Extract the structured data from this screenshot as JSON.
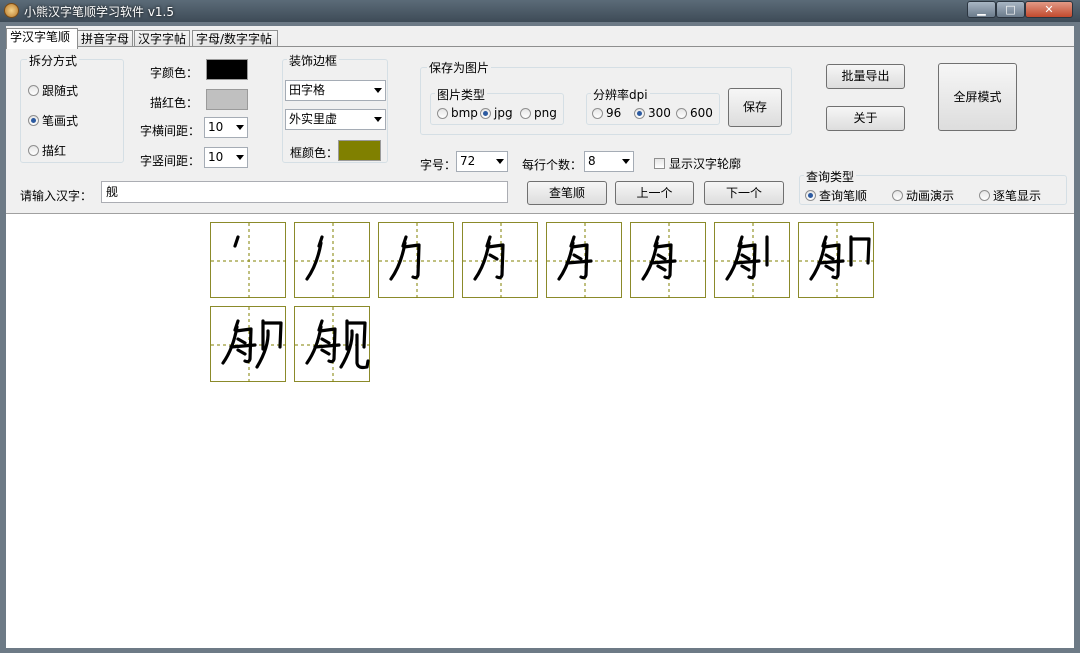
{
  "window": {
    "title": "小熊汉字笔顺学习软件 v1.5"
  },
  "tabs": [
    "学汉字笔顺",
    "拼音字母",
    "汉字字帖",
    "字母/数字字帖"
  ],
  "split": {
    "title": "拆分方式",
    "options": [
      "跟随式",
      "笔画式",
      "描红"
    ],
    "selected": 1
  },
  "colors": {
    "char_label": "字颜色：",
    "char_color": "#000000",
    "trace_label": "描红色：",
    "trace_color": "#c0c0c0",
    "frame_label": "框颜色：",
    "frame_color": "#808000"
  },
  "spacing": {
    "h_label": "字横间距：",
    "h_value": "10",
    "v_label": "字竖间距：",
    "v_value": "10"
  },
  "border": {
    "title": "装饰边框",
    "style_value": "田字格",
    "outline_value": "外实里虚"
  },
  "save": {
    "title": "保存为图片",
    "type_title": "图片类型",
    "types": [
      "bmp",
      "jpg",
      "png"
    ],
    "type_selected": 1,
    "dpi_title": "分辨率dpi",
    "dpis": [
      "96",
      "300",
      "600"
    ],
    "dpi_selected": 1,
    "save_button": "保存"
  },
  "font_size": {
    "label": "字号：",
    "value": "72"
  },
  "per_row": {
    "label": "每行个数：",
    "value": "8"
  },
  "outline_check": {
    "label": "显示汉字轮廓",
    "checked": false
  },
  "buttons": {
    "batch_export": "批量导出",
    "about": "关于",
    "fullscreen": "全屏模式",
    "query": "查笔顺",
    "prev": "上一个",
    "next": "下一个"
  },
  "input": {
    "label": "请输入汉字：",
    "value": "舰"
  },
  "query_type": {
    "title": "查询类型",
    "options": [
      "查询笔顺",
      "动画演示",
      "逐笔显示"
    ],
    "selected": 0
  },
  "stroke_grid": {
    "character": "舰",
    "cells": 10,
    "per_row": 8
  }
}
